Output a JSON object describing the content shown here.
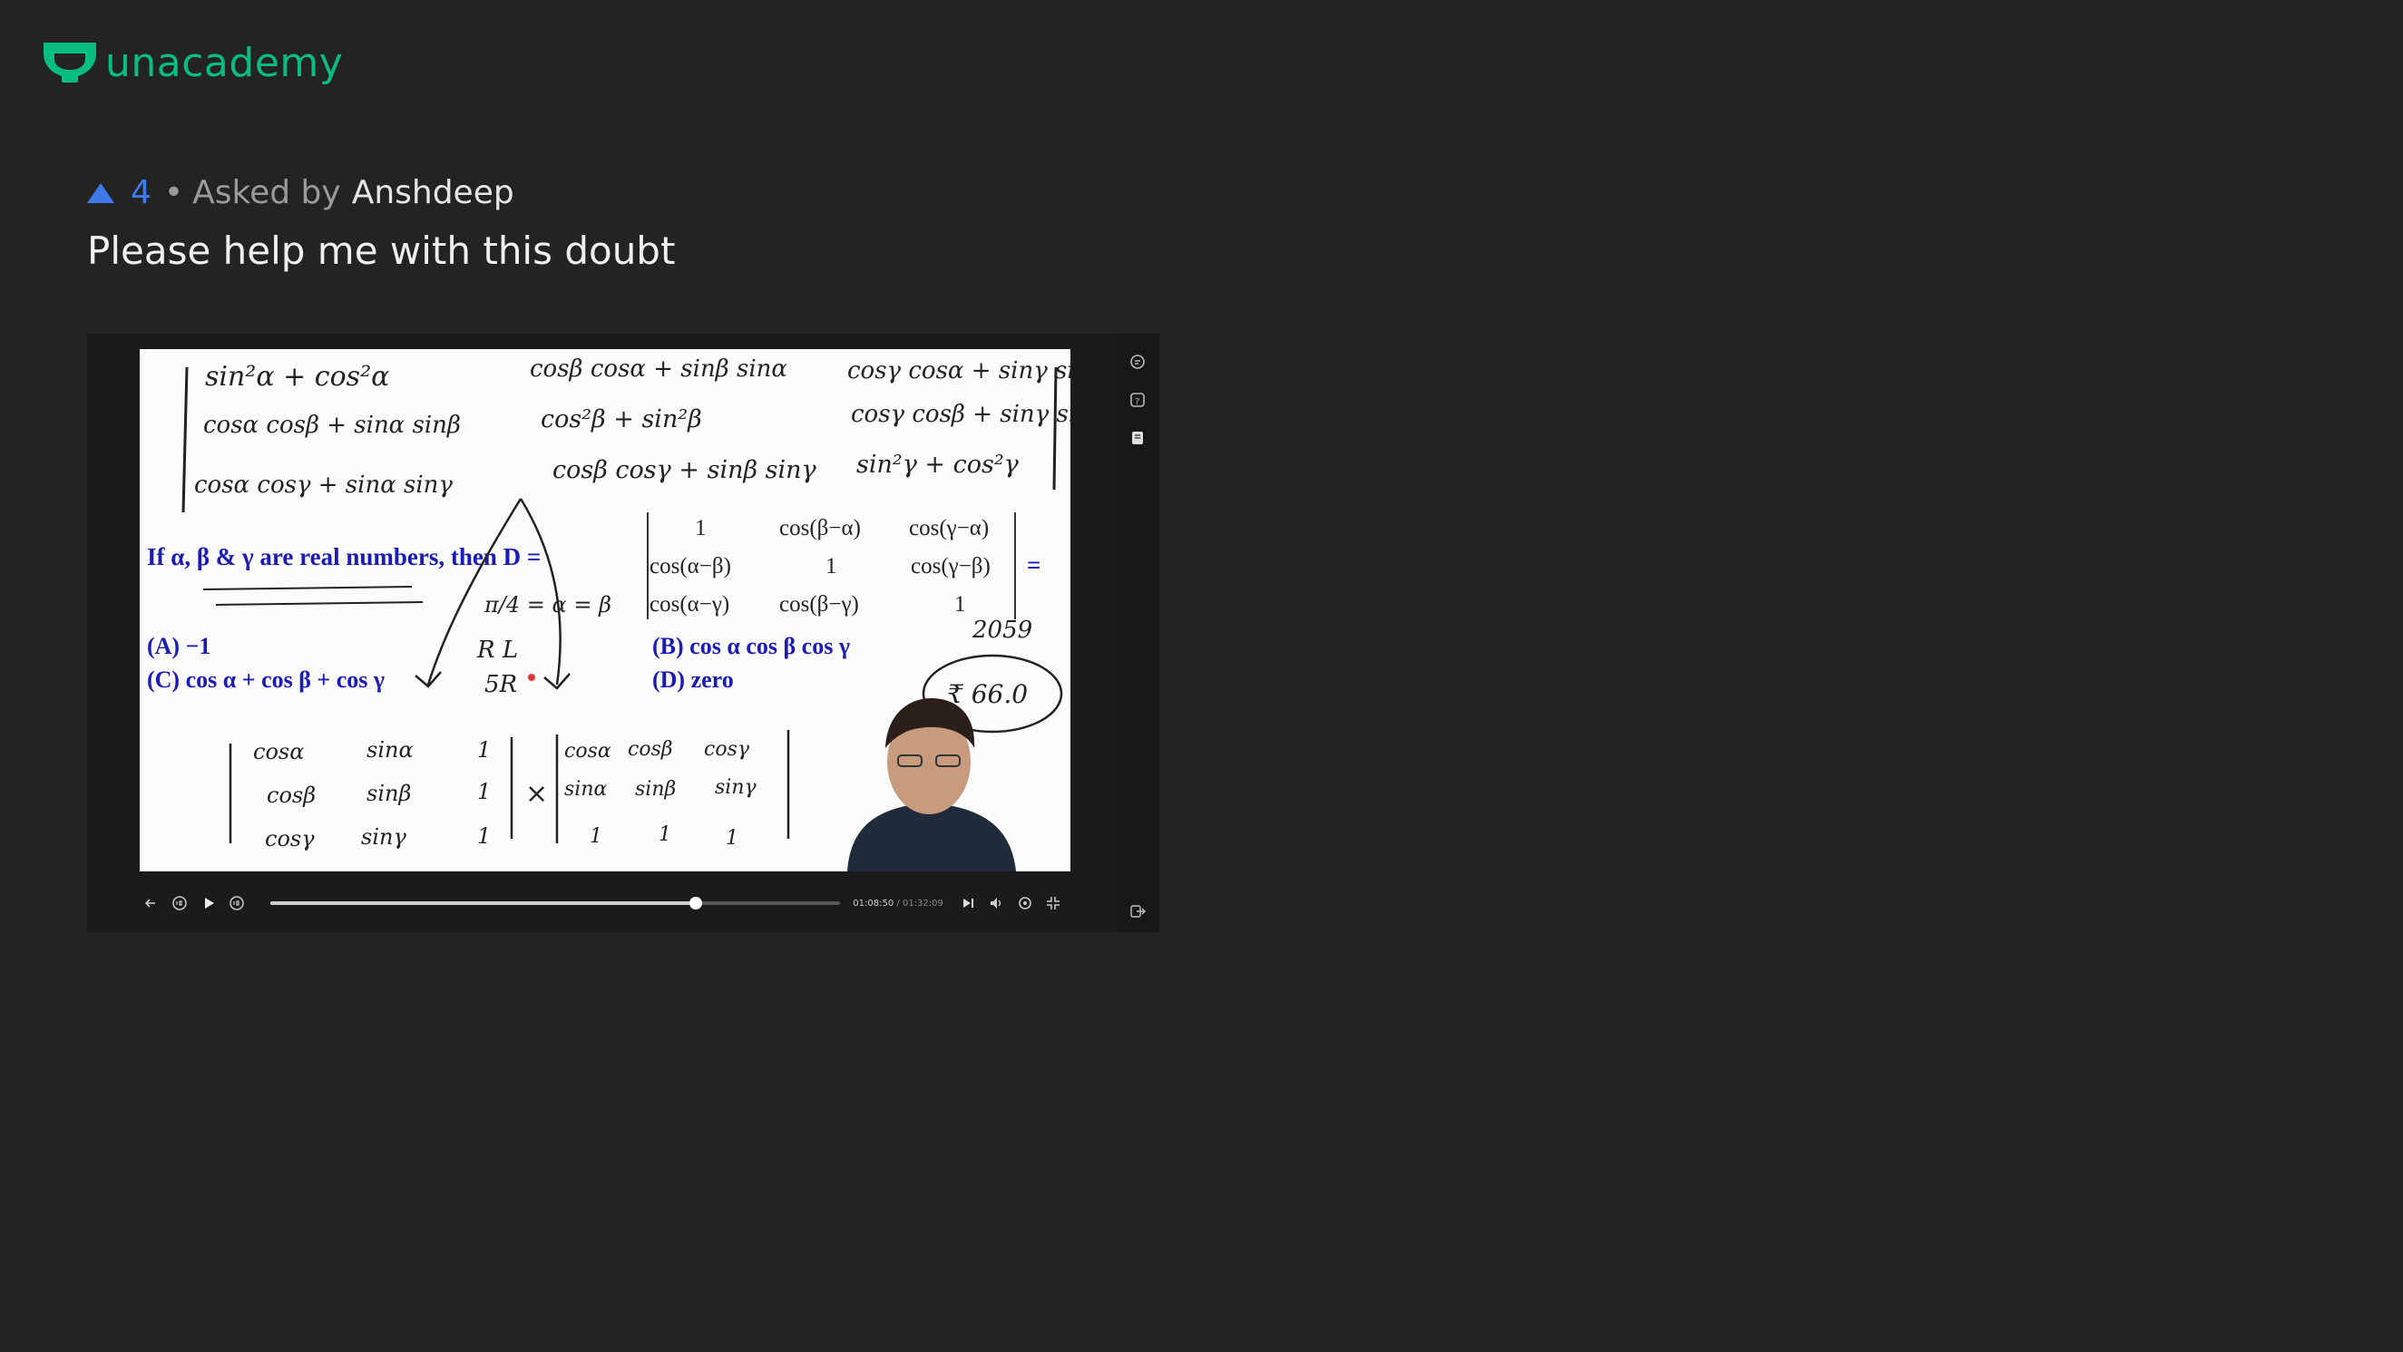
{
  "brand": {
    "name": "unacademy",
    "color": "#08bd80"
  },
  "question": {
    "upvotes": "4",
    "asked_by_prefix": "Asked by",
    "asker": "Anshdeep",
    "text": "Please help me with this doubt"
  },
  "board": {
    "question_line": "If  α, β & γ  are real numbers,  then  D =",
    "matrix": [
      [
        "1",
        "cos(β−α)",
        "cos(γ−α)"
      ],
      [
        "cos(α−β)",
        "1",
        "cos(γ−β)"
      ],
      [
        "cos(α−γ)",
        "cos(β−γ)",
        "1"
      ]
    ],
    "equals": "=",
    "options": {
      "a": "(A)  −1",
      "b": "(B) cos α  cos β  cos γ",
      "c": "(C)  cos α + cos β + cos γ",
      "d": "(D)  zero"
    },
    "handwriting": {
      "r1c1": "sin²α + cos²α",
      "r1c2": "cosβ cosα + sinβ sinα",
      "r1c3": "cosγ cosα + sinγ sinα",
      "r2c1": "cosα cosβ + sinα sinβ",
      "r2c2": "cos²β + sin²β",
      "r2c3": "cosγ cosβ + sinγ sinβ",
      "r3c1": "cosα cosγ + sinα sinγ",
      "r3c2": "cosβ cosγ + sinβ sinγ",
      "r3c3": "sin²γ + cos²γ",
      "pi4": "π/4 = α = β",
      "rl": "R L",
      "five_r": "5R",
      "n2059": "2059",
      "circled": "₹ 66.0",
      "m1": [
        "cosα",
        "sinα",
        "1"
      ],
      "m2": [
        "cosβ",
        "sinβ",
        "1"
      ],
      "m3": [
        "cosγ",
        "sinγ",
        "1"
      ],
      "n1": [
        "cosα",
        "cosβ",
        "cosγ"
      ],
      "n2": [
        "sinα",
        "sinβ",
        "sinγ"
      ],
      "n3": [
        "1",
        "1",
        "1"
      ],
      "times": "×"
    }
  },
  "player": {
    "current_time": "01:08:50",
    "separator": "/",
    "duration": "01:32:09",
    "progress_fraction": 0.747
  }
}
